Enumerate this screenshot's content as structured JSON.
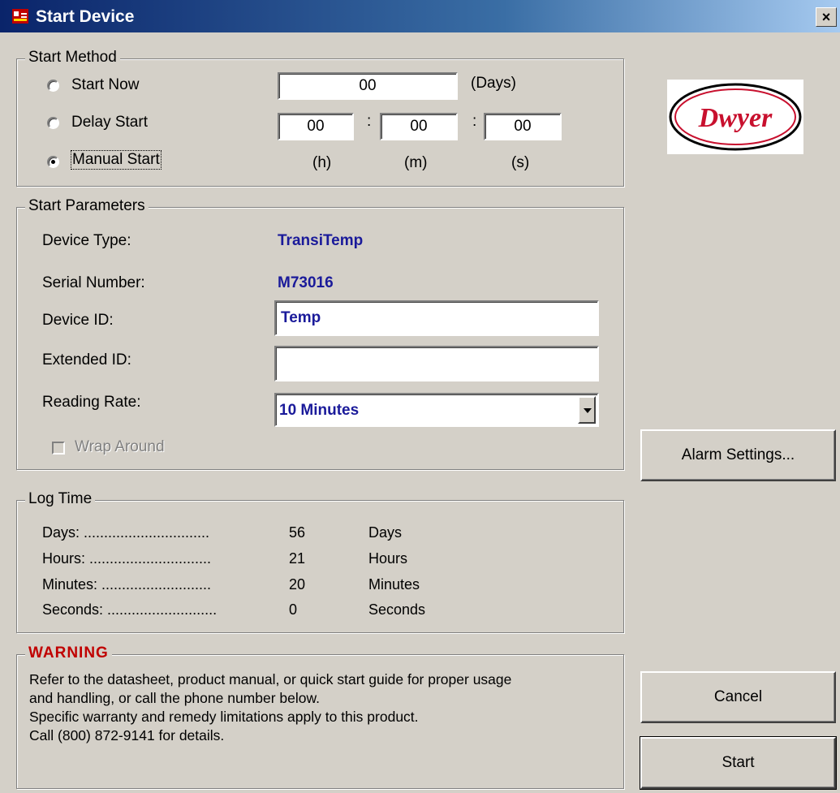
{
  "window": {
    "title": "Start Device",
    "close_label": "×"
  },
  "start_method": {
    "legend": "Start Method",
    "options": [
      "Start Now",
      "Delay Start",
      "Manual Start"
    ],
    "selected": "Manual Start",
    "days_value": "00",
    "days_unit": "(Days)",
    "hours_value": "00",
    "minutes_value": "00",
    "seconds_value": "00",
    "separator": ":",
    "h_label": "(h)",
    "m_label": "(m)",
    "s_label": "(s)"
  },
  "start_parameters": {
    "legend": "Start Parameters",
    "device_type_label": "Device Type:",
    "device_type_value": "TransiTemp",
    "serial_label": "Serial Number:",
    "serial_value": "M73016",
    "device_id_label": "Device ID:",
    "device_id_value": "Temp",
    "extended_id_label": "Extended ID:",
    "extended_id_value": "",
    "reading_rate_label": "Reading Rate:",
    "reading_rate_value": "10 Minutes",
    "wrap_around_label": "Wrap Around"
  },
  "log_time": {
    "legend": "Log Time",
    "rows": [
      {
        "label": "Days: ...............................",
        "value": "56",
        "unit": "Days"
      },
      {
        "label": "Hours: ..............................",
        "value": "21",
        "unit": "Hours"
      },
      {
        "label": "Minutes: ...........................",
        "value": "20",
        "unit": "Minutes"
      },
      {
        "label": "Seconds: ...........................",
        "value": "0",
        "unit": "Seconds"
      }
    ]
  },
  "warning": {
    "legend": "WARNING",
    "lines": [
      "Refer to the datasheet, product manual, or quick start guide for proper usage",
      "and handling, or call the phone number below.",
      "Specific warranty and remedy limitations apply to this product.",
      "Call (800) 872-9141 for details."
    ]
  },
  "buttons": {
    "alarm_settings": "Alarm Settings...",
    "cancel": "Cancel",
    "start": "Start"
  },
  "logo": {
    "text": "Dwyer",
    "color": "#c8102e"
  }
}
